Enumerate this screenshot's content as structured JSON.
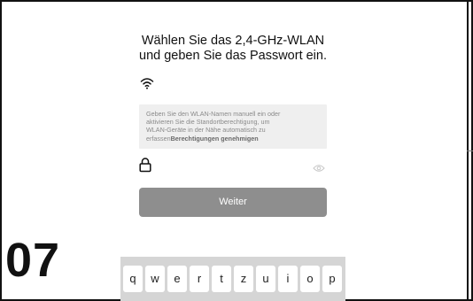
{
  "step_number": "07",
  "title": {
    "line1": "Wählen Sie das 2,4-GHz-WLAN",
    "line2": "und geben Sie das Passwort ein."
  },
  "wifi_field": {
    "icon": "wifi-icon",
    "value": ""
  },
  "hint": {
    "text_line1": "Geben Sie den WLAN-Namen manuell ein oder",
    "text_line2": "aktivieren Sie die Standortberechtigung, um",
    "text_line3": "WLAN-Geräte in der Nähe automatisch zu",
    "text_line4_prefix": "erfassen",
    "link": "Berechtigungen genehmigen"
  },
  "password_field": {
    "icon": "lock-icon",
    "toggle_icon": "eye-icon",
    "value": ""
  },
  "button": {
    "label": "Weiter",
    "color": "#8e8e8e"
  },
  "keyboard": {
    "keys": [
      "q",
      "w",
      "e",
      "r",
      "t",
      "z",
      "u",
      "i",
      "o",
      "p"
    ]
  }
}
